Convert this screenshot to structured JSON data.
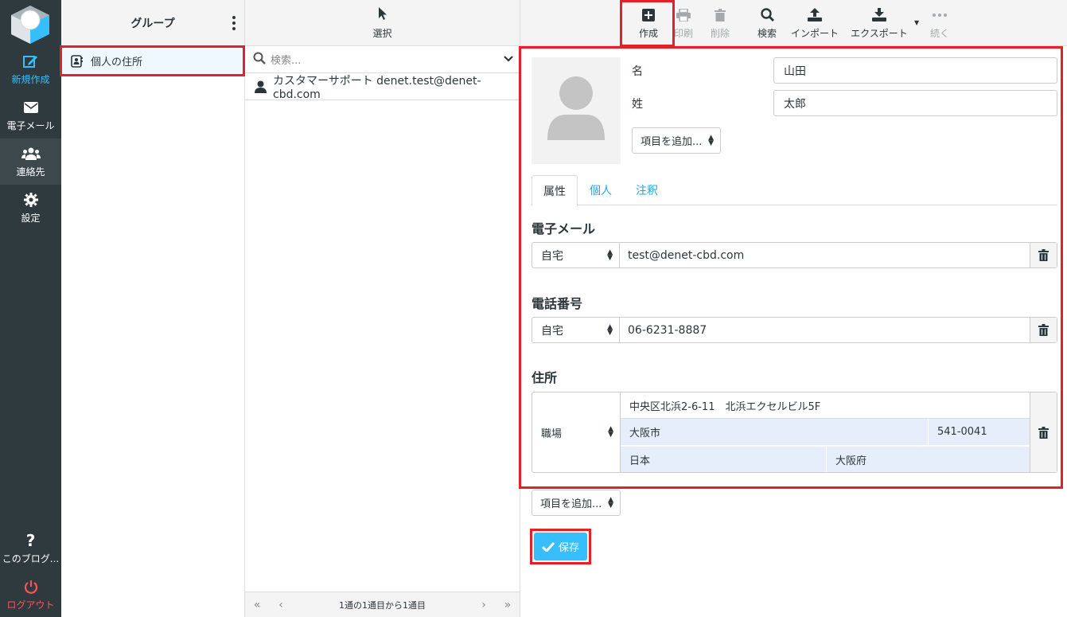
{
  "nav": {
    "compose": "新規作成",
    "mail": "電子メール",
    "contacts": "連絡先",
    "settings": "設定",
    "about": "このブログ...",
    "logout": "ログアウト"
  },
  "groups": {
    "title": "グループ",
    "items": [
      {
        "label": "個人の住所"
      }
    ]
  },
  "list": {
    "select_label": "選択",
    "search_placeholder": "検索...",
    "contacts": [
      {
        "name": "カスタマーサポート denet.test@denet-cbd.com"
      }
    ],
    "pagination": "1通の1通目から1通目"
  },
  "toolbar": {
    "create": "作成",
    "print": "印刷",
    "delete": "削除",
    "search": "検索",
    "import": "インポート",
    "export": "エクスポート",
    "more": "続く"
  },
  "form": {
    "first_name_label": "名",
    "first_name_value": "山田",
    "last_name_label": "姓",
    "last_name_value": "太郎",
    "add_field": "項目を追加...",
    "tabs": [
      "属性",
      "個人",
      "注釈"
    ],
    "email": {
      "title": "電子メール",
      "type": "自宅",
      "value": "test@denet-cbd.com"
    },
    "phone": {
      "title": "電話番号",
      "type": "自宅",
      "value": "06-6231-8887"
    },
    "address": {
      "title": "住所",
      "type": "職場",
      "street": "中央区北浜2-6-11　北浜エクセルビル5F",
      "city": "大阪市",
      "zip": "541-0041",
      "country": "日本",
      "region": "大阪府"
    },
    "add_field_bottom": "項目を追加...",
    "save": "保存"
  },
  "colors": {
    "accent": "#37beff",
    "highlight": "#e3212a",
    "nav_bg": "#2f3a3f",
    "logout": "#ff5552"
  }
}
